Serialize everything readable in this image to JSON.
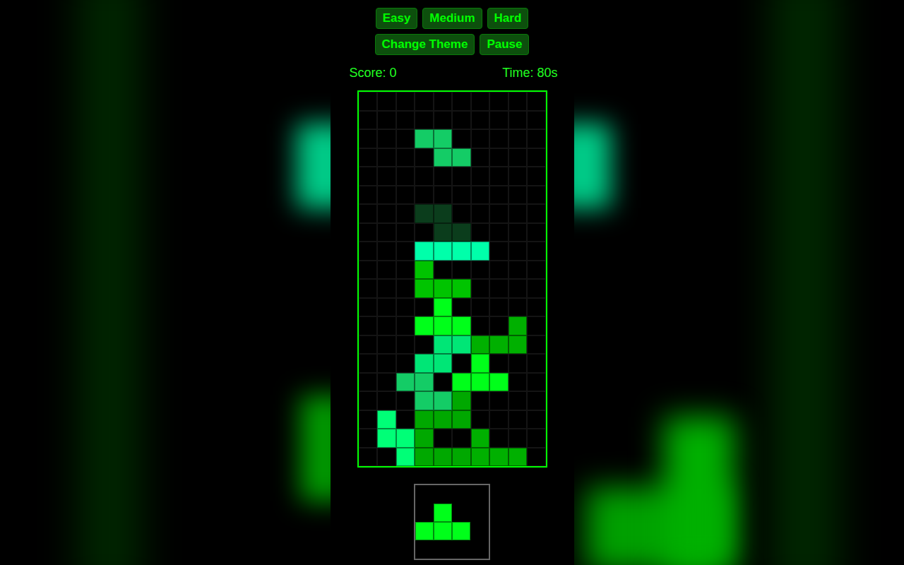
{
  "difficulty_buttons": [
    {
      "label": "Easy"
    },
    {
      "label": "Medium"
    },
    {
      "label": "Hard"
    }
  ],
  "control_buttons": [
    {
      "label": "Change Theme"
    },
    {
      "label": "Pause"
    }
  ],
  "score": "Score: 0",
  "time": "Time: 80s",
  "board": {
    "rows": [
      [
        "",
        "",
        "",
        "",
        "",
        "",
        "",
        "",
        "",
        ""
      ],
      [
        "",
        "",
        "",
        "",
        "",
        "",
        "",
        "",
        "",
        ""
      ],
      [
        "",
        "",
        "",
        "",
        "",
        "",
        "",
        "",
        "",
        ""
      ],
      [
        "",
        "",
        "",
        "",
        "",
        "",
        "",
        "",
        "",
        ""
      ],
      [
        "",
        "",
        "",
        "",
        "",
        "",
        "",
        "",
        "",
        ""
      ],
      [
        "",
        "",
        "",
        "",
        "",
        "",
        "",
        "",
        "",
        ""
      ],
      [
        "",
        "",
        "",
        "",
        "",
        "",
        "",
        "",
        "",
        ""
      ],
      [
        "",
        "",
        "",
        "",
        "",
        "",
        "",
        "",
        "",
        ""
      ],
      [
        "",
        "",
        "",
        "#00ffaa",
        "#00ffaa",
        "#00ffaa",
        "#00ffaa",
        "",
        "",
        ""
      ],
      [
        "",
        "",
        "",
        "#00c400",
        "",
        "",
        "",
        "",
        "",
        ""
      ],
      [
        "",
        "",
        "",
        "#00c400",
        "#00c400",
        "#00c400",
        "",
        "",
        "",
        ""
      ],
      [
        "",
        "",
        "",
        "",
        "#00ff1a",
        "",
        "",
        "",
        "",
        ""
      ],
      [
        "",
        "",
        "",
        "#00ff1a",
        "#00ff1a",
        "#00ff1a",
        "",
        "",
        "#00b000",
        ""
      ],
      [
        "",
        "",
        "",
        "",
        "#00e676",
        "#00e676",
        "#00b000",
        "#00b000",
        "#00b000",
        ""
      ],
      [
        "",
        "",
        "",
        "#00e676",
        "#00e676",
        "",
        "#00ff1a",
        "",
        "",
        ""
      ],
      [
        "",
        "",
        "#14cc66",
        "#14cc66",
        "",
        "#00ff1a",
        "#00ff1a",
        "#00ff1a",
        "",
        ""
      ],
      [
        "",
        "",
        "",
        "#14cc66",
        "#14cc66",
        "#00a800",
        "",
        "",
        "",
        ""
      ],
      [
        "",
        "#00ff77",
        "",
        "#00a800",
        "#00a800",
        "#00a800",
        "",
        "",
        "",
        ""
      ],
      [
        "",
        "#00ff77",
        "#00ff77",
        "#00a800",
        "",
        "",
        "#00b000",
        "",
        "",
        ""
      ],
      [
        "",
        "",
        "#00ff77",
        "#00a800",
        "#00a800",
        "#00a800",
        "#00b000",
        "#00b000",
        "#00b000",
        ""
      ]
    ]
  },
  "ghost_piece": {
    "color": "#0b3d1c",
    "cells": [
      [
        6,
        3
      ],
      [
        6,
        4
      ],
      [
        7,
        4
      ],
      [
        7,
        5
      ]
    ]
  },
  "active_piece": {
    "color": "#14cc66",
    "cells": [
      [
        2,
        3
      ],
      [
        2,
        4
      ],
      [
        3,
        4
      ],
      [
        3,
        5
      ]
    ]
  },
  "next_piece": {
    "color": "#00ff1a",
    "cells": [
      [
        1,
        1
      ],
      [
        2,
        0
      ],
      [
        2,
        1
      ],
      [
        2,
        2
      ]
    ]
  }
}
